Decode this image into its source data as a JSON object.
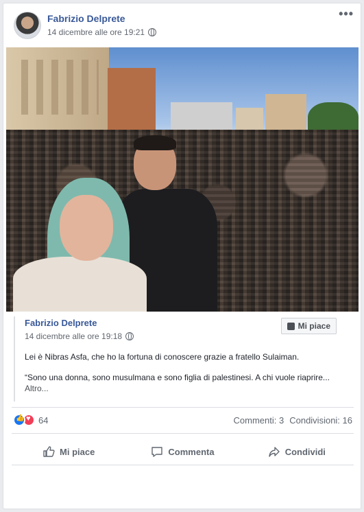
{
  "post": {
    "author": "Fabrizio Delprete",
    "timestamp": "14 dicembre alle ore 19:21",
    "privacy_icon": "globe-icon",
    "more_label": "•••"
  },
  "shared_post": {
    "author": "Fabrizio Delprete",
    "timestamp": "14 dicembre alle ore 19:18",
    "like_page_label": "Mi piace",
    "text_line1": "Lei è Nibras Asfa, che ho la fortuna di conoscere grazie a fratello Sulaiman.",
    "text_line2": "“Sono una donna, sono musulmana e sono figlia di palestinesi. A chi vuole riaprire...",
    "see_more": "Altro..."
  },
  "stats": {
    "reaction_count": "64",
    "comments": "Commenti: 3",
    "shares": "Condivisioni: 16",
    "colors": {
      "like": "#1877f2",
      "love": "#f33e58"
    }
  },
  "actions": {
    "like": "Mi piace",
    "comment": "Commenta",
    "share": "Condividi"
  }
}
